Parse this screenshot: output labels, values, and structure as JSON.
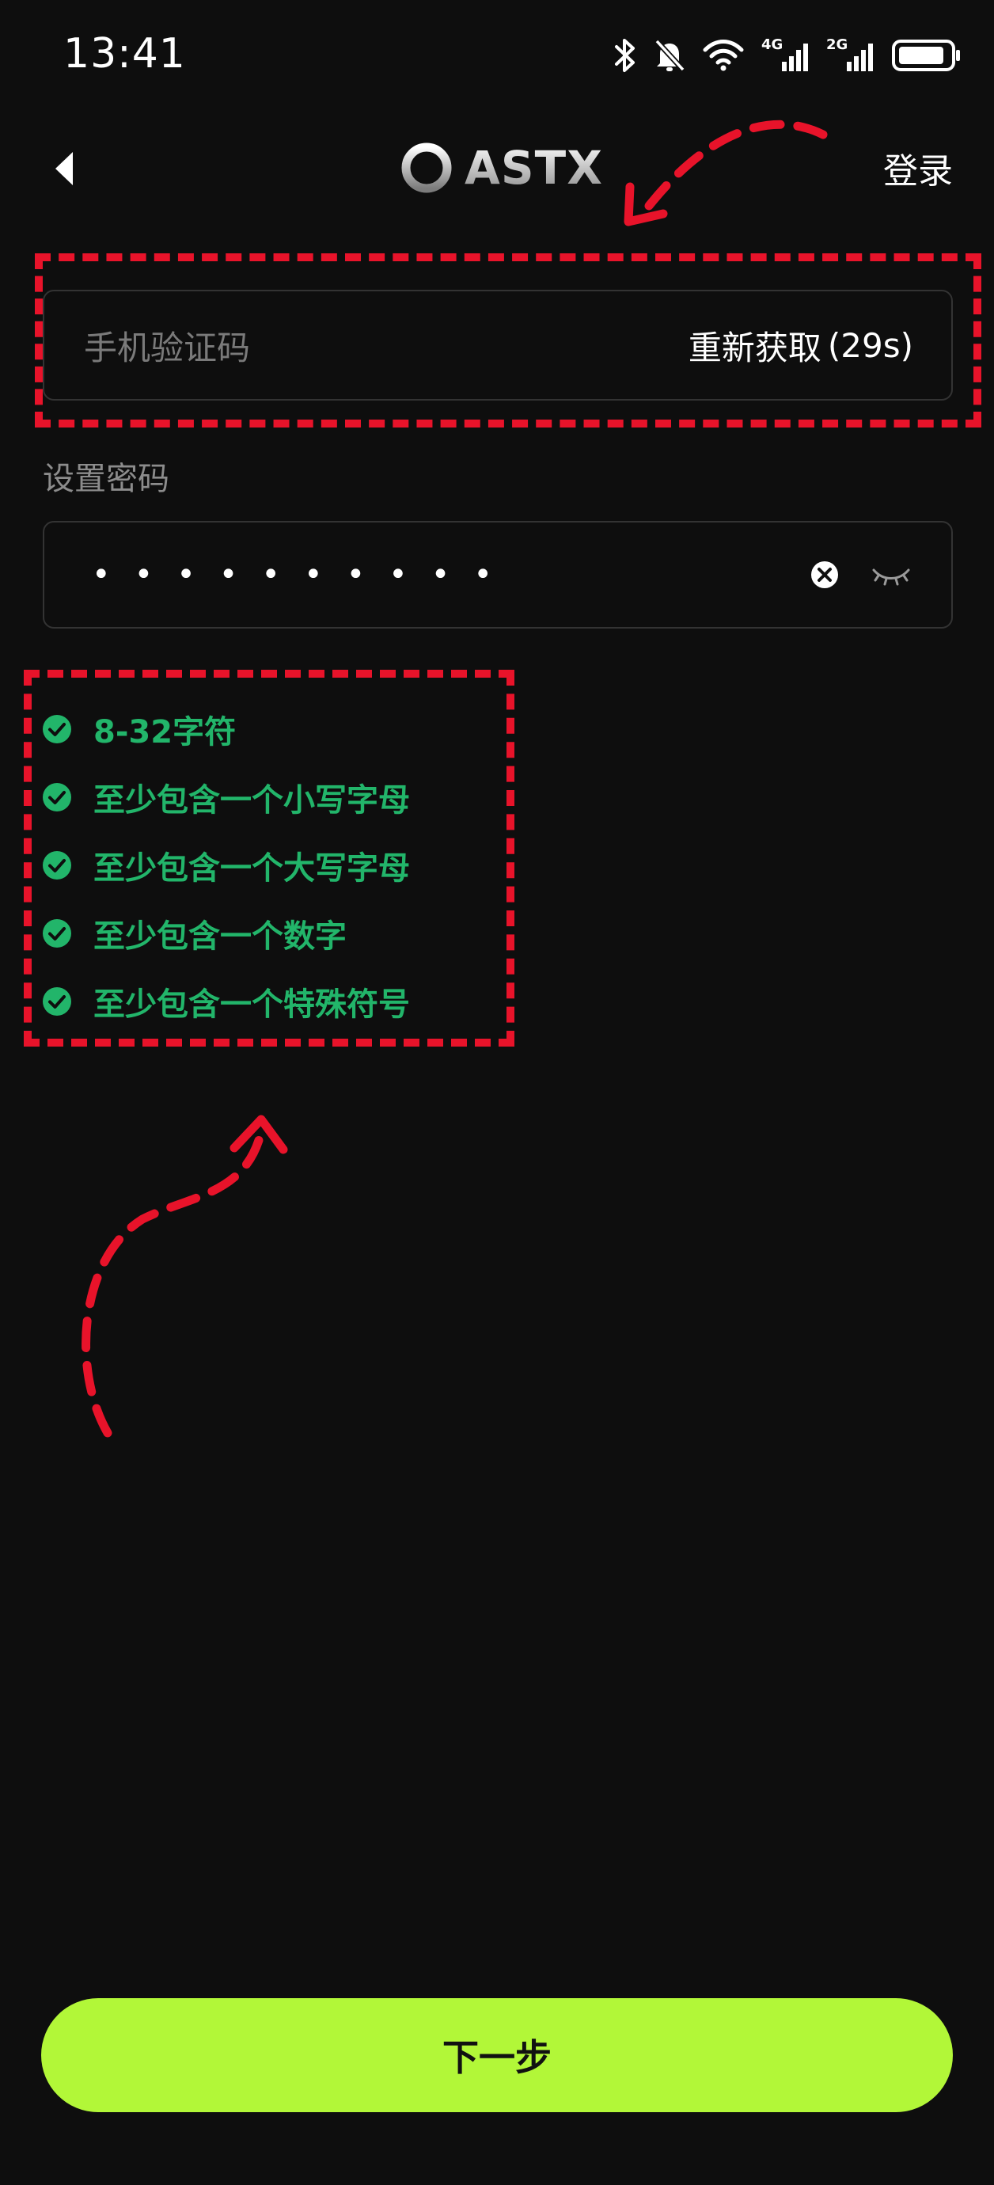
{
  "status_bar": {
    "time": "13:41",
    "icons": [
      "bluetooth-icon",
      "mute-bell-icon",
      "wifi-icon",
      "signal-4g-icon",
      "signal-2g-icon",
      "battery-icon"
    ],
    "network_1": "4G",
    "network_2": "2G"
  },
  "nav": {
    "back_icon": "chevron-left-icon",
    "logo_text": "ASTX",
    "login_label": "登录"
  },
  "sms_code": {
    "placeholder": "手机验证码",
    "resend_label": "重新获取",
    "countdown": "(29s)"
  },
  "password": {
    "label": "设置密码",
    "masked_value": "••••••••••",
    "clear_icon": "clear-circle-icon",
    "visibility_icon": "eye-closed-icon"
  },
  "rules": [
    {
      "text": "8-32字符",
      "met": true
    },
    {
      "text": "至少包含一个小写字母",
      "met": true
    },
    {
      "text": "至少包含一个大写字母",
      "met": true
    },
    {
      "text": "至少包含一个数字",
      "met": true
    },
    {
      "text": "至少包含一个特殊符号",
      "met": true
    }
  ],
  "next_button": {
    "label": "下一步"
  },
  "colors": {
    "background": "#0e0e0e",
    "accent_button": "#b2f738",
    "rule_ok": "#22b56a",
    "annotation": "#e8132a"
  }
}
